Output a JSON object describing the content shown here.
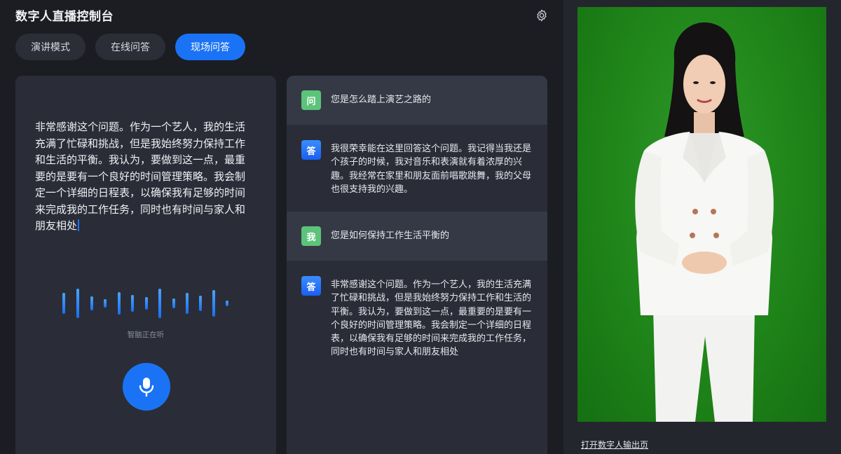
{
  "header": {
    "title": "数字人直播控制台",
    "settings_icon": "gear-icon"
  },
  "tabs": [
    {
      "label": "演讲模式",
      "active": false
    },
    {
      "label": "在线问答",
      "active": false
    },
    {
      "label": "现场问答",
      "active": true
    }
  ],
  "speech": {
    "text": "非常感谢这个问题。作为一个艺人，我的生活充满了忙碌和挑战，但是我始终努力保持工作和生活的平衡。我认为，要做到这一点，最重要的是要有一个良好的时间管理策略。我会制定一个详细的日程表，以确保我有足够的时间来完成我的工作任务，同时也有时间与家人和朋友相处",
    "status": "智脑正在听",
    "mic_icon": "microphone-icon"
  },
  "qa": [
    {
      "badge": "问",
      "type": "question",
      "text": "您是怎么踏上演艺之路的"
    },
    {
      "badge": "答",
      "type": "answer",
      "text": "我很荣幸能在这里回答这个问题。我记得当我还是个孩子的时候，我对音乐和表演就有着浓厚的兴趣。我经常在家里和朋友面前唱歌跳舞，我的父母也很支持我的兴趣。"
    },
    {
      "badge": "我",
      "type": "question",
      "text": "您是如何保持工作生活平衡的"
    },
    {
      "badge": "答",
      "type": "answer",
      "text": "非常感谢这个问题。作为一个艺人，我的生活充满了忙碌和挑战，但是我始终努力保持工作和生活的平衡。我认为，要做到这一点，最重要的是要有一个良好的时间管理策略。我会制定一个详细的日程表，以确保我有足够的时间来完成我的工作任务，同时也有时间与家人和朋友相处"
    }
  ],
  "preview": {
    "link_label": "打开数字人输出页"
  },
  "colors": {
    "accent": "#1a73f5",
    "green_screen": "#1f8419",
    "badge_green": "#5cc47a"
  }
}
